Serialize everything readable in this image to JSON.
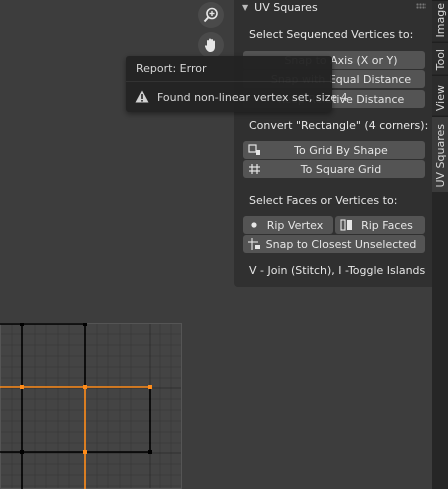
{
  "panel": {
    "title": "UV Squares",
    "section1_label": "Select Sequenced Vertices to:",
    "buttons_seq": [
      "Snap to Axis (X or Y)",
      "Snap with Equal Distance",
      "Keep Relative Distance"
    ],
    "section2_label": "Convert \"Rectangle\" (4 corners):",
    "to_grid_label": "To Grid By Shape",
    "to_square_label": "To Square Grid",
    "section3_label": "Select Faces or Vertices to:",
    "rip_vertex_label": "Rip Vertex",
    "rip_faces_label": "Rip Faces",
    "snap_closest_label": "Snap to Closest Unselected",
    "hint": "V - Join (Stitch), I -Toggle Islands"
  },
  "tabs": {
    "image": "Image",
    "tool": "Tool",
    "view": "View",
    "uv_squares": "UV Squares"
  },
  "tooltip": {
    "title": "Report: Error",
    "message": "Found non-linear vertex set, size 4"
  },
  "navigation": {
    "zoom_icon": "zoom-in-icon",
    "pan_icon": "hand-icon"
  },
  "colors": {
    "background": "#3d3d3d",
    "panel": "#303030",
    "button": "#545454",
    "uv_edge_selected": "#ff8c1a",
    "uv_edge": "#000000"
  }
}
